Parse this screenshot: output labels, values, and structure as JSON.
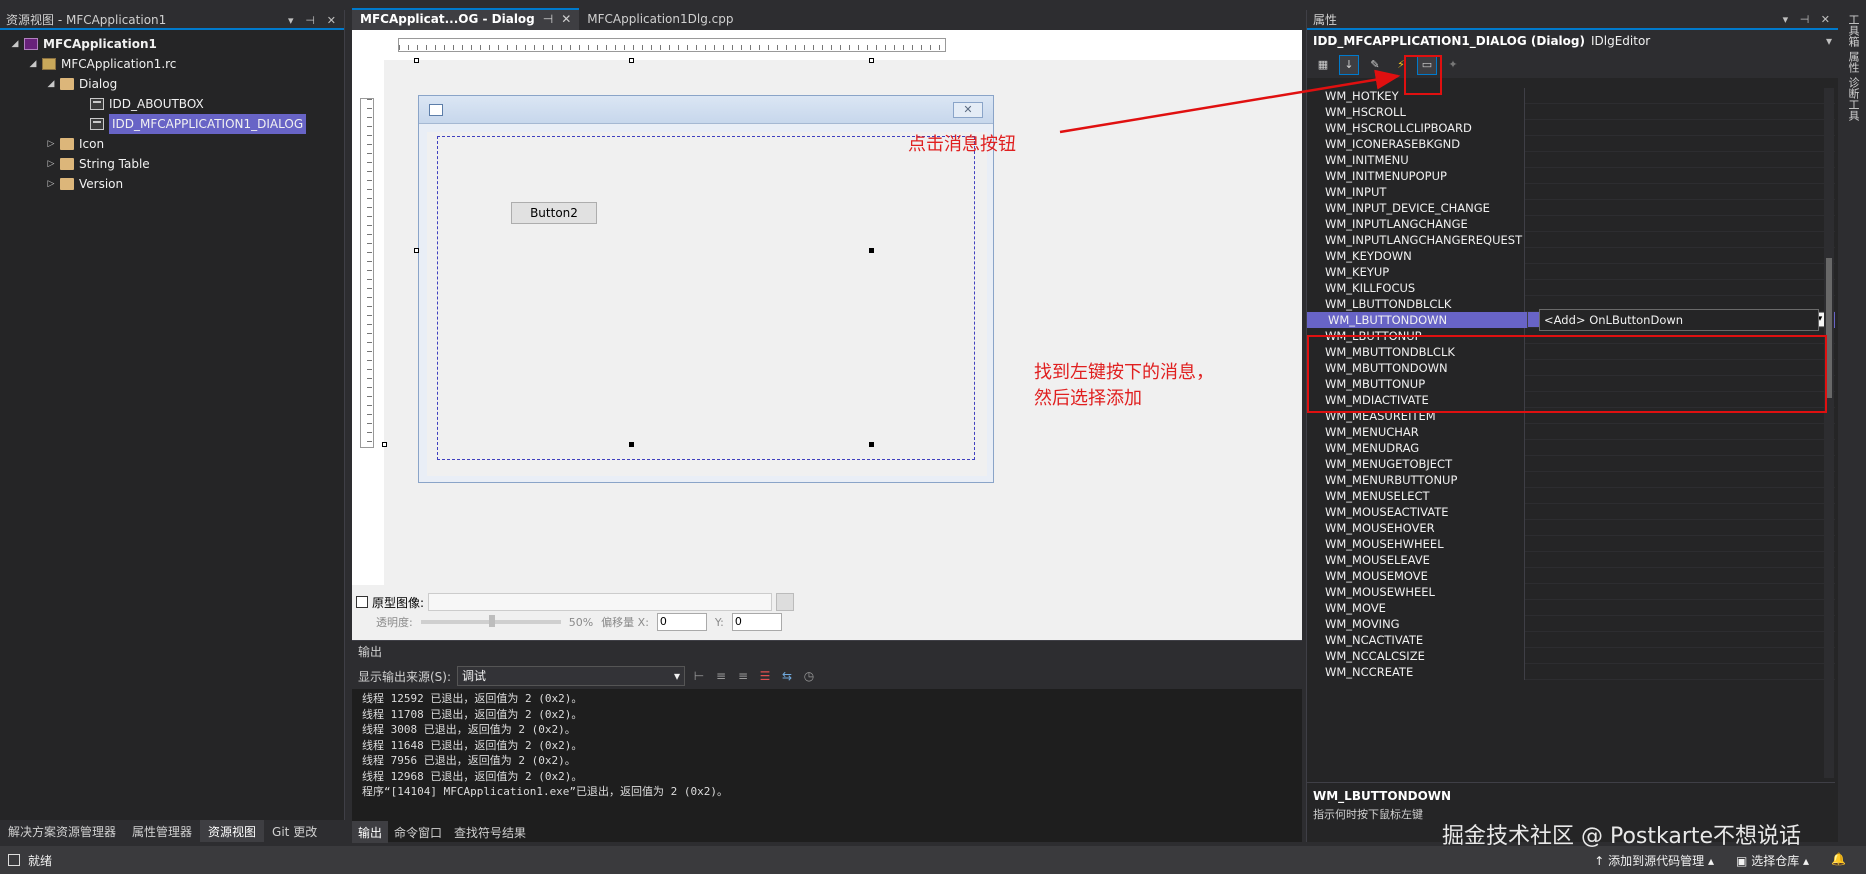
{
  "left_panel": {
    "title": "资源视图 - MFCApplication1",
    "title_icons": [
      "▾",
      "⊣",
      "✕"
    ],
    "tree": [
      {
        "label": "MFCApplication1",
        "bold": true,
        "level": 0,
        "expander": "◢",
        "icon": "project-icon"
      },
      {
        "label": "MFCApplication1.rc",
        "level": 1,
        "expander": "◢",
        "icon": "rc-file-icon"
      },
      {
        "label": "Dialog",
        "level": 2,
        "expander": "◢",
        "icon": "folder-icon"
      },
      {
        "label": "IDD_ABOUTBOX",
        "level": 3,
        "expander": "",
        "icon": "dialog-icon"
      },
      {
        "label": "IDD_MFCAPPLICATION1_DIALOG",
        "level": 3,
        "expander": "",
        "icon": "dialog-icon",
        "selected": true
      },
      {
        "label": "Icon",
        "level": 2,
        "expander": "▷",
        "icon": "folder-icon"
      },
      {
        "label": "String Table",
        "level": 2,
        "expander": "▷",
        "icon": "folder-icon"
      },
      {
        "label": "Version",
        "level": 2,
        "expander": "▷",
        "icon": "folder-icon"
      }
    ],
    "bottom_tabs": [
      "解决方案资源管理器",
      "属性管理器",
      "资源视图",
      "Git 更改"
    ],
    "active_bottom_tab": "资源视图"
  },
  "editor": {
    "tabs": [
      {
        "label": "MFCApplicat...OG - Dialog",
        "active": true,
        "pin": "⊣",
        "close": "✕"
      },
      {
        "label": "MFCApplication1Dlg.cpp",
        "active": false
      }
    ],
    "dialog_close_glyph": "✕",
    "button_label": "Button2",
    "prototype": {
      "checkbox_label": "原型图像:",
      "transparency_label": "透明度:",
      "transparency_value": "50%",
      "offset_label": "偏移量 X:",
      "x_value": "0",
      "y_label": "Y:",
      "y_value": "0"
    }
  },
  "output_panel": {
    "title": "输出",
    "source_label": "显示输出来源(S):",
    "source_value": "调试",
    "lines": [
      "线程 12592 已退出，返回值为 2 (0x2)。",
      "线程 11708 已退出，返回值为 2 (0x2)。",
      "线程 3008 已退出，返回值为 2 (0x2)。",
      "线程 11648 已退出，返回值为 2 (0x2)。",
      "线程 7956 已退出，返回值为 2 (0x2)。",
      "线程 12968 已退出，返回值为 2 (0x2)。",
      "程序“[14104] MFCApplication1.exe”已退出，返回值为 2 (0x2)。"
    ],
    "bottom_tabs": [
      "输出",
      "命令窗口",
      "查找符号结果"
    ],
    "active_bottom_tab": "输出"
  },
  "properties_panel": {
    "title": "属性",
    "title_icons": [
      "▾",
      "⊣",
      "✕"
    ],
    "object_name": "IDD_MFCAPPLICATION1_DIALOG (Dialog)",
    "object_editor": "IDlgEditor",
    "messages": [
      "WM_HOTKEY",
      "WM_HSCROLL",
      "WM_HSCROLLCLIPBOARD",
      "WM_ICONERASEBKGND",
      "WM_INITMENU",
      "WM_INITMENUPOPUP",
      "WM_INPUT",
      "WM_INPUT_DEVICE_CHANGE",
      "WM_INPUTLANGCHANGE",
      "WM_INPUTLANGCHANGEREQUEST",
      "WM_KEYDOWN",
      "WM_KEYUP",
      "WM_KILLFOCUS",
      "WM_LBUTTONDBLCLK",
      "WM_LBUTTONDOWN",
      "WM_LBUTTONUP",
      "WM_MBUTTONDBLCLK",
      "WM_MBUTTONDOWN",
      "WM_MBUTTONUP",
      "WM_MDIACTIVATE",
      "WM_MEASUREITEM",
      "WM_MENUCHAR",
      "WM_MENUDRAG",
      "WM_MENUGETOBJECT",
      "WM_MENURBUTTONUP",
      "WM_MENUSELECT",
      "WM_MOUSEACTIVATE",
      "WM_MOUSEHOVER",
      "WM_MOUSEHWHEEL",
      "WM_MOUSELEAVE",
      "WM_MOUSEMOVE",
      "WM_MOUSEWHEEL",
      "WM_MOVE",
      "WM_MOVING",
      "WM_NCACTIVATE",
      "WM_NCCALCSIZE",
      "WM_NCCREATE"
    ],
    "selected_message": "WM_LBUTTONDOWN",
    "dropdown_option": "<Add> OnLButtonDown",
    "description_title": "WM_LBUTTONDOWN",
    "description_text": "指示何时按下鼠标左键"
  },
  "side_strip": [
    "工具箱",
    "属性",
    "诊断工具"
  ],
  "status_bar": {
    "ready": "就绪",
    "source_control": "添加到源代码管理",
    "repo": "选择仓库"
  },
  "annotations": {
    "click_message_button": "点击消息按钮",
    "find_message_line1": "找到左键按下的消息，",
    "find_message_line2": "然后选择添加"
  },
  "watermark": "掘金技术社区 @ Postkarte不想说话",
  "colors": {
    "accent": "#007acc",
    "selection": "#6864c6",
    "annotation_red": "#e02020"
  }
}
